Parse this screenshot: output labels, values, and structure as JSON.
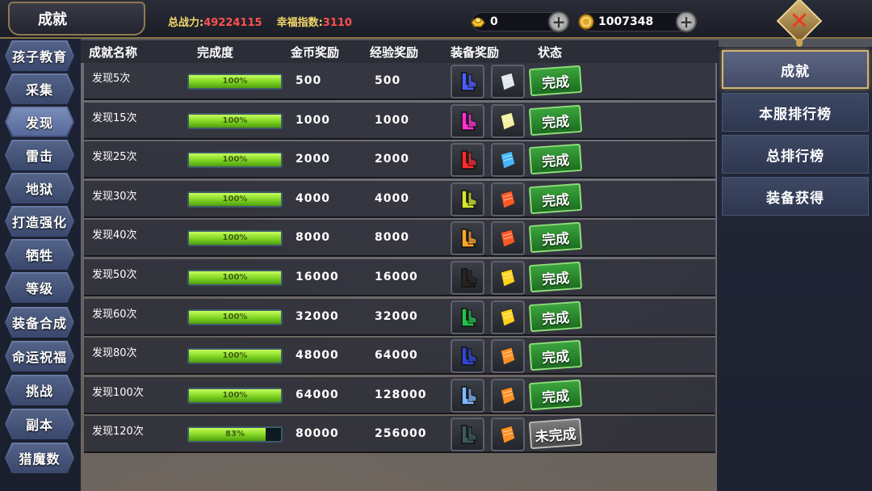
{
  "header": {
    "title": "成就",
    "power_label": "总战力:",
    "power_value": "49224115",
    "luck_label": "幸福指数:",
    "luck_value": "3110",
    "gold_ingot": "0",
    "coins": "1007348"
  },
  "left_nav": [
    {
      "label": "孩子教育"
    },
    {
      "label": "采集"
    },
    {
      "label": "发现"
    },
    {
      "label": "雷击"
    },
    {
      "label": "地狱"
    },
    {
      "label": "打造强化"
    },
    {
      "label": "牺牲"
    },
    {
      "label": "等级"
    },
    {
      "label": "装备合成"
    },
    {
      "label": "命运祝福"
    },
    {
      "label": "挑战"
    },
    {
      "label": "副本"
    },
    {
      "label": "猎魔数"
    }
  ],
  "table": {
    "headers": {
      "name": "成就名称",
      "progress": "完成度",
      "gold": "金币奖励",
      "exp": "经验奖励",
      "equip": "装备奖励",
      "status": "状态"
    },
    "rows": [
      {
        "name": "发现5次",
        "progress_text": "100%",
        "progress": 100,
        "gold": "500",
        "exp": "500",
        "status": "完成",
        "done": true,
        "item1": "#4a5cff",
        "item2": "#dfe7ef"
      },
      {
        "name": "发现15次",
        "progress_text": "100%",
        "progress": 100,
        "gold": "1000",
        "exp": "1000",
        "status": "完成",
        "done": true,
        "item1": "#ff2fd2",
        "item2": "#f4f0a2"
      },
      {
        "name": "发现25次",
        "progress_text": "100%",
        "progress": 100,
        "gold": "2000",
        "exp": "2000",
        "status": "完成",
        "done": true,
        "item1": "#ff2a2a",
        "item2": "#45b7ff"
      },
      {
        "name": "发现30次",
        "progress_text": "100%",
        "progress": 100,
        "gold": "4000",
        "exp": "4000",
        "status": "完成",
        "done": true,
        "item1": "#d6e82c",
        "item2": "#ff5a24"
      },
      {
        "name": "发现40次",
        "progress_text": "100%",
        "progress": 100,
        "gold": "8000",
        "exp": "8000",
        "status": "完成",
        "done": true,
        "item1": "#ffa52a",
        "item2": "#ff5a24"
      },
      {
        "name": "发现50次",
        "progress_text": "100%",
        "progress": 100,
        "gold": "16000",
        "exp": "16000",
        "status": "完成",
        "done": true,
        "item1": "#2a2320",
        "item2": "#ffd21c"
      },
      {
        "name": "发现60次",
        "progress_text": "100%",
        "progress": 100,
        "gold": "32000",
        "exp": "32000",
        "status": "完成",
        "done": true,
        "item1": "#22c24a",
        "item2": "#ffd21c"
      },
      {
        "name": "发现80次",
        "progress_text": "100%",
        "progress": 100,
        "gold": "48000",
        "exp": "64000",
        "status": "完成",
        "done": true,
        "item1": "#2d46d6",
        "item2": "#ff8f24"
      },
      {
        "name": "发现100次",
        "progress_text": "100%",
        "progress": 100,
        "gold": "64000",
        "exp": "128000",
        "status": "完成",
        "done": true,
        "item1": "#7fb8ff",
        "item2": "#ff8f24"
      },
      {
        "name": "发现120次",
        "progress_text": "83%",
        "progress": 83,
        "gold": "80000",
        "exp": "256000",
        "status": "未完成",
        "done": false,
        "item1": "#3b5a5f",
        "item2": "#ff8f24"
      }
    ]
  },
  "right_tabs": [
    {
      "label": "成就"
    },
    {
      "label": "本服排行榜"
    },
    {
      "label": "总排行榜"
    },
    {
      "label": "装备获得"
    }
  ]
}
